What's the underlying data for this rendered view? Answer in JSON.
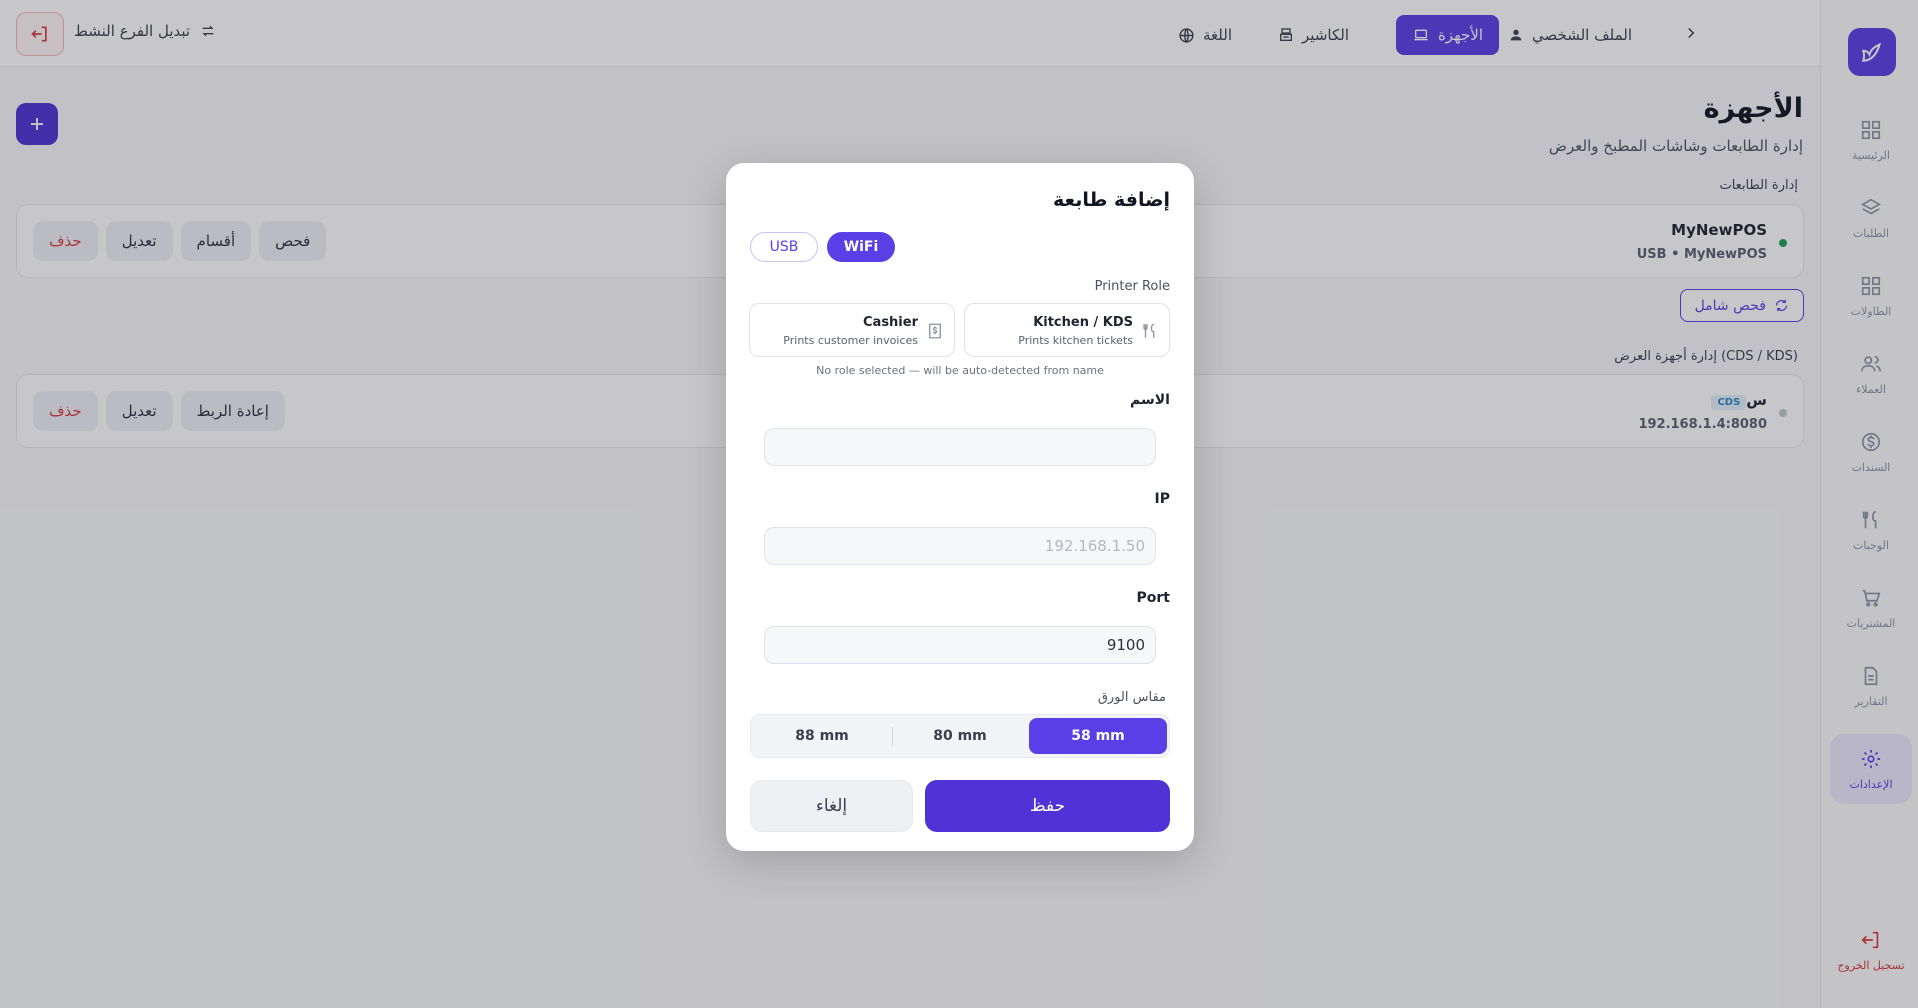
{
  "topbar": {
    "profile": "الملف الشخصي",
    "devices": "الأجهزة",
    "cashier": "الكاشير",
    "language": "اللغة",
    "switch_branch": "تبديل الفرع النشط"
  },
  "sidebar": {
    "items": [
      {
        "label": "الرئيسية",
        "icon": "dashboard-icon"
      },
      {
        "label": "الطلبات",
        "icon": "layers-icon"
      },
      {
        "label": "الطاولات",
        "icon": "grid-icon"
      },
      {
        "label": "العملاء",
        "icon": "users-icon"
      },
      {
        "label": "السندات",
        "icon": "dollar-icon"
      },
      {
        "label": "الوجبات",
        "icon": "utensils-icon"
      },
      {
        "label": "المشتريات",
        "icon": "cart-icon"
      },
      {
        "label": "التقارير",
        "icon": "file-icon"
      },
      {
        "label": "الإعدادات",
        "icon": "gear-icon"
      }
    ],
    "logout": "تسجيل الخروج",
    "active": "الإعدادات"
  },
  "page": {
    "title": "الأجهزة",
    "subtitle": "إدارة الطابعات وشاشات المطبخ والعرض",
    "printers_section": "إدارة الطابعات",
    "scan_all": "فحص شامل",
    "cds_section": "إدارة أجهزة العرض (CDS / KDS)"
  },
  "printer_card": {
    "name": "MyNewPOS",
    "sub": "USB • MyNewPOS",
    "status_color": "#1e9e5a",
    "actions": {
      "scan": "فحص",
      "sections": "أقسام",
      "edit": "تعديل",
      "delete": "حذف"
    }
  },
  "cds_card": {
    "name": "س",
    "tag": "CDS",
    "sub": "192.168.1.4:8080",
    "status_color": "#c4c7cf",
    "actions": {
      "reconnect": "إعادة الربط",
      "edit": "تعديل",
      "delete": "حذف"
    }
  },
  "modal": {
    "title": "إضافة طابعة",
    "conn_wifi": "WiFi",
    "conn_usb": "USB",
    "role_label": "Printer Role",
    "role_kitchen_title": "Kitchen / KDS",
    "role_kitchen_sub": "Prints kitchen tickets",
    "role_cashier_title": "Cashier",
    "role_cashier_sub": "Prints customer invoices",
    "role_note": "No role selected — will be auto-detected from name",
    "name_label": "الاسم",
    "name_value": "",
    "ip_label": "IP",
    "ip_placeholder": "192.168.1.50",
    "port_label": "Port",
    "port_value": "9100",
    "paper_label": "مقاس الورق",
    "paper_options": [
      "58 mm",
      "80 mm",
      "88 mm"
    ],
    "paper_selected": "58 mm",
    "save": "حفظ",
    "cancel": "إلغاء"
  },
  "colors": {
    "accent": "#5a3fe6",
    "danger": "#d9383e"
  }
}
